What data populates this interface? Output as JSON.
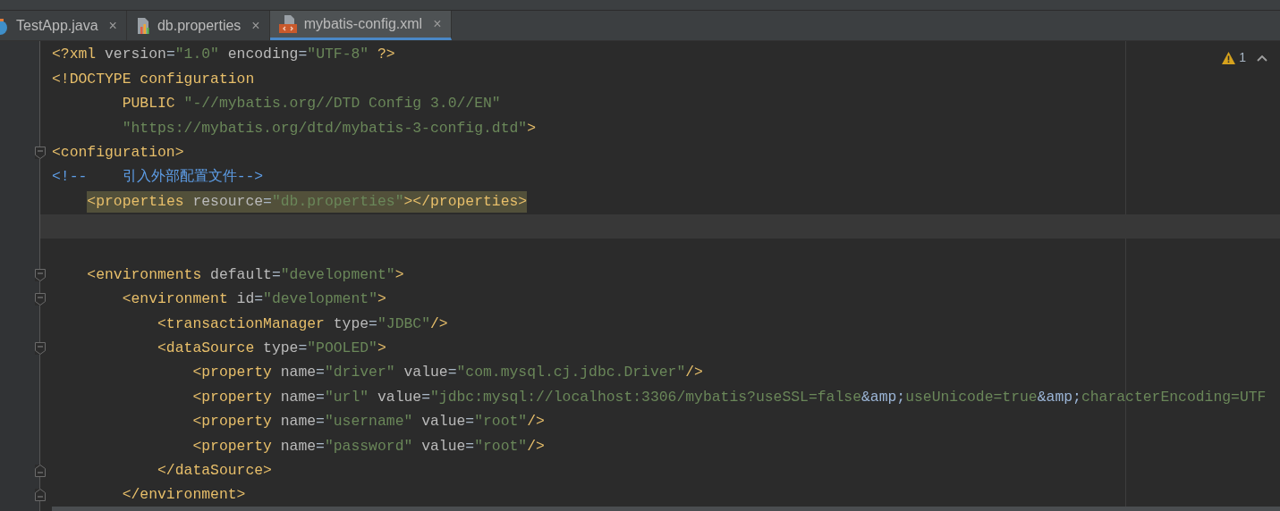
{
  "tabs": [
    {
      "label": "TestApp.java",
      "kind": "java",
      "close": "×",
      "selected": false
    },
    {
      "label": "db.properties",
      "kind": "properties",
      "close": "×",
      "selected": false
    },
    {
      "label": "mybatis-config.xml",
      "kind": "xml",
      "close": "×",
      "selected": true
    }
  ],
  "inspection": {
    "warnings": "1"
  },
  "lines": [
    {
      "fold_start": false,
      "fold_end": false,
      "current": false,
      "tokens": [
        {
          "kind": "tag",
          "text": "<?xml"
        },
        {
          "kind": "attr",
          "text": " version"
        },
        {
          "kind": "eq",
          "text": "="
        },
        {
          "kind": "str",
          "text": "\"1.0\""
        },
        {
          "kind": "attr",
          "text": " encoding"
        },
        {
          "kind": "eq",
          "text": "="
        },
        {
          "kind": "str",
          "text": "\"UTF-8\""
        },
        {
          "kind": "tag",
          "text": " ?>"
        }
      ]
    },
    {
      "fold_start": false,
      "fold_end": false,
      "current": false,
      "tokens": [
        {
          "kind": "tag",
          "text": "<!DOCTYPE configuration"
        }
      ]
    },
    {
      "fold_start": false,
      "fold_end": false,
      "current": false,
      "tokens": [
        {
          "kind": "tag",
          "text": "        PUBLIC "
        },
        {
          "kind": "str",
          "text": "\"-//mybatis.org//DTD Config 3.0//EN\""
        }
      ]
    },
    {
      "fold_start": false,
      "fold_end": false,
      "current": false,
      "tokens": [
        {
          "kind": "str",
          "text": "        \"https://mybatis.org/dtd/mybatis-3-config.dtd\""
        },
        {
          "kind": "tag",
          "text": ">"
        }
      ]
    },
    {
      "fold_start": true,
      "fold_end": false,
      "current": false,
      "tokens": [
        {
          "kind": "tag",
          "text": "<configuration>"
        }
      ]
    },
    {
      "fold_start": false,
      "fold_end": false,
      "current": false,
      "tokens": [
        {
          "kind": "comment",
          "text": "<!--    引入外部配置文件-->"
        }
      ]
    },
    {
      "fold_start": false,
      "fold_end": false,
      "current": false,
      "tokens": [
        {
          "kind": "tag",
          "text": "    <properties",
          "highlight": true
        },
        {
          "kind": "attr",
          "text": " resource",
          "highlight": true
        },
        {
          "kind": "eq",
          "text": "=",
          "highlight": true
        },
        {
          "kind": "str",
          "text": "\"db.properties\"",
          "highlight": true
        },
        {
          "kind": "tag",
          "text": "></properties>",
          "highlight": true
        }
      ]
    },
    {
      "fold_start": false,
      "fold_end": false,
      "current": true
    },
    {
      "fold_start": false,
      "fold_end": false,
      "current": false
    },
    {
      "fold_start": true,
      "fold_end": false,
      "current": false,
      "tokens": [
        {
          "kind": "tag",
          "text": "    <environments"
        },
        {
          "kind": "attr",
          "text": " default"
        },
        {
          "kind": "eq",
          "text": "="
        },
        {
          "kind": "str",
          "text": "\"development\""
        },
        {
          "kind": "tag",
          "text": ">"
        }
      ]
    },
    {
      "fold_start": true,
      "fold_end": false,
      "current": false,
      "tokens": [
        {
          "kind": "tag",
          "text": "        <environment"
        },
        {
          "kind": "attr",
          "text": " id"
        },
        {
          "kind": "eq",
          "text": "="
        },
        {
          "kind": "str",
          "text": "\"development\""
        },
        {
          "kind": "tag",
          "text": ">"
        }
      ]
    },
    {
      "fold_start": false,
      "fold_end": false,
      "current": false,
      "tokens": [
        {
          "kind": "tag",
          "text": "            <transactionManager"
        },
        {
          "kind": "attr",
          "text": " type"
        },
        {
          "kind": "eq",
          "text": "="
        },
        {
          "kind": "str",
          "text": "\"JDBC\""
        },
        {
          "kind": "tag",
          "text": "/>"
        }
      ]
    },
    {
      "fold_start": true,
      "fold_end": false,
      "current": false,
      "tokens": [
        {
          "kind": "tag",
          "text": "            <dataSource"
        },
        {
          "kind": "attr",
          "text": " type"
        },
        {
          "kind": "eq",
          "text": "="
        },
        {
          "kind": "str",
          "text": "\"POOLED\""
        },
        {
          "kind": "tag",
          "text": ">"
        }
      ]
    },
    {
      "fold_start": false,
      "fold_end": false,
      "current": false,
      "tokens": [
        {
          "kind": "tag",
          "text": "                <property"
        },
        {
          "kind": "attr",
          "text": " name"
        },
        {
          "kind": "eq",
          "text": "="
        },
        {
          "kind": "str",
          "text": "\"driver\""
        },
        {
          "kind": "attr",
          "text": " value"
        },
        {
          "kind": "eq",
          "text": "="
        },
        {
          "kind": "str",
          "text": "\"com.mysql.cj.jdbc.Driver\""
        },
        {
          "kind": "tag",
          "text": "/>"
        }
      ]
    },
    {
      "fold_start": false,
      "fold_end": false,
      "current": false,
      "tokens": [
        {
          "kind": "tag",
          "text": "                <property"
        },
        {
          "kind": "attr",
          "text": " name"
        },
        {
          "kind": "eq",
          "text": "="
        },
        {
          "kind": "str",
          "text": "\"url\""
        },
        {
          "kind": "attr",
          "text": " value"
        },
        {
          "kind": "eq",
          "text": "="
        },
        {
          "kind": "str",
          "text": "\"jdbc:mysql://localhost:3306/mybatis?useSSL=false"
        },
        {
          "kind": "entity",
          "text": "&amp;"
        },
        {
          "kind": "str",
          "text": "useUnicode=true"
        },
        {
          "kind": "entity",
          "text": "&amp;"
        },
        {
          "kind": "str",
          "text": "characterEncoding=UTF"
        }
      ]
    },
    {
      "fold_start": false,
      "fold_end": false,
      "current": false,
      "tokens": [
        {
          "kind": "tag",
          "text": "                <property"
        },
        {
          "kind": "attr",
          "text": " name"
        },
        {
          "kind": "eq",
          "text": "="
        },
        {
          "kind": "str",
          "text": "\"username\""
        },
        {
          "kind": "attr",
          "text": " value"
        },
        {
          "kind": "eq",
          "text": "="
        },
        {
          "kind": "str",
          "text": "\"root\""
        },
        {
          "kind": "tag",
          "text": "/>"
        }
      ]
    },
    {
      "fold_start": false,
      "fold_end": false,
      "current": false,
      "tokens": [
        {
          "kind": "tag",
          "text": "                <property"
        },
        {
          "kind": "attr",
          "text": " name"
        },
        {
          "kind": "eq",
          "text": "="
        },
        {
          "kind": "str",
          "text": "\"password\""
        },
        {
          "kind": "attr",
          "text": " value"
        },
        {
          "kind": "eq",
          "text": "="
        },
        {
          "kind": "str",
          "text": "\"root\""
        },
        {
          "kind": "tag",
          "text": "/>"
        }
      ]
    },
    {
      "fold_start": false,
      "fold_end": true,
      "current": false,
      "tokens": [
        {
          "kind": "tag",
          "text": "            </dataSource>"
        }
      ]
    },
    {
      "fold_start": false,
      "fold_end": true,
      "current": false,
      "tokens": [
        {
          "kind": "tag",
          "text": "        </environment>"
        }
      ]
    }
  ]
}
